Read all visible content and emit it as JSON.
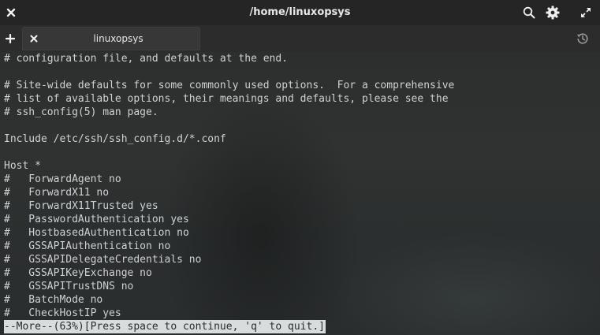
{
  "window": {
    "title": "/home/linuxopsys"
  },
  "tabs": [
    {
      "label": "linuxopsys",
      "active": true
    }
  ],
  "terminal": {
    "lines": [
      "# configuration file, and defaults at the end.",
      "",
      "# Site-wide defaults for some commonly used options.  For a comprehensive",
      "# list of available options, their meanings and defaults, please see the",
      "# ssh_config(5) man page.",
      "",
      "Include /etc/ssh/ssh_config.d/*.conf",
      "",
      "Host *",
      "#   ForwardAgent no",
      "#   ForwardX11 no",
      "#   ForwardX11Trusted yes",
      "#   PasswordAuthentication yes",
      "#   HostbasedAuthentication no",
      "#   GSSAPIAuthentication no",
      "#   GSSAPIDelegateCredentials no",
      "#   GSSAPIKeyExchange no",
      "#   GSSAPITrustDNS no",
      "#   BatchMode no",
      "#   CheckHostIP yes"
    ],
    "pager_prompt": "--More--(63%)[Press space to continue, 'q' to quit.]"
  },
  "icons": {
    "close": "close-icon",
    "search": "search-icon",
    "settings": "gear-icon",
    "maximize": "maximize-icon",
    "new_tab": "plus-icon",
    "tab_close": "close-icon",
    "history": "history-icon"
  },
  "colors": {
    "titlebar": "#252525",
    "tabbar": "#2c2c2c",
    "active_tab": "#373737",
    "terminal_text": "#cfd2d2",
    "pager_bg": "#d8dcdc"
  }
}
